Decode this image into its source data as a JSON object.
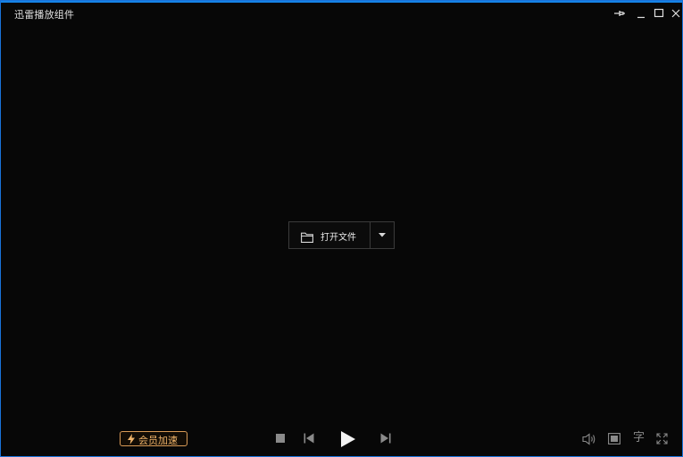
{
  "window": {
    "title": "迅雷播放组件"
  },
  "titlebar_buttons": {
    "pin": "pin-icon",
    "minimize": "minimize-icon",
    "maximize": "maximize-icon",
    "close": "close-icon"
  },
  "center": {
    "open_file_label": "打开文件",
    "folder_icon": "folder-icon",
    "dropdown_icon": "caret-down-icon"
  },
  "controls": {
    "vip_label": "会员加速",
    "vip_icon": "lightning-icon",
    "stop_icon": "stop-icon",
    "prev_icon": "previous-icon",
    "play_icon": "play-icon",
    "next_icon": "next-icon",
    "volume_icon": "volume-icon",
    "screen_icon": "screen-ratio-icon",
    "subtitle_label": "字",
    "fullscreen_icon": "fullscreen-icon"
  },
  "colors": {
    "accent_border": "#1583e6",
    "background": "#070707",
    "vip_color": "#f0b46a"
  }
}
